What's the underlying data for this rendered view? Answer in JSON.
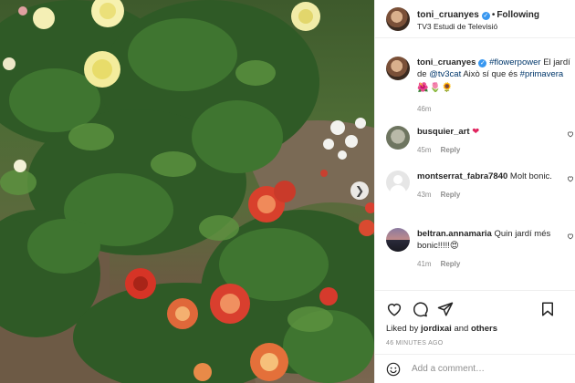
{
  "post": {
    "username": "toni_cruanyes",
    "follow_label": "Following",
    "location": "TV3 Estudi de Televisió"
  },
  "caption": {
    "username": "toni_cruanyes",
    "hashtag": "#flowerpower",
    "text1": " El jardí de ",
    "mention": "@tv3cat",
    "text2": " Això sí que és ",
    "hashtag2": "#primavera",
    "emojis": "🌺🌷🌻",
    "time": "46m"
  },
  "comments": [
    {
      "username": "busquier_art",
      "text": "❤",
      "time": "45m",
      "reply": "Reply",
      "avatar": "grey"
    },
    {
      "username": "montserrat_fabra7840",
      "text": "Molt bonic.",
      "time": "43m",
      "reply": "Reply",
      "avatar": "blank"
    },
    {
      "username": "beltran.annamaria",
      "text": "Quin jardí més bonic!!!!!😍",
      "time": "41m",
      "reply": "Reply",
      "avatar": "sunset"
    }
  ],
  "likes": {
    "prefix": "Liked by ",
    "user": "jordixai",
    "joiner": " and ",
    "others": "others"
  },
  "posted_ago": "46 MINUTES AGO",
  "add_comment_placeholder": "Add a comment…",
  "colors": {
    "link": "#00376b",
    "verified": "#3897f0",
    "muted": "#8e8e8e"
  }
}
